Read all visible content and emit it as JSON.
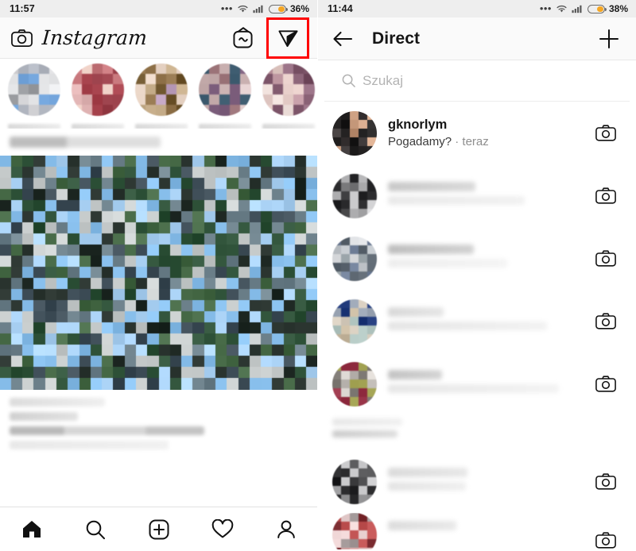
{
  "left_panel": {
    "statusbar": {
      "time": "11:57",
      "dots": "•••",
      "battery_percent": "36%",
      "battery_level": 36,
      "wifi_icon": "wifi-icon",
      "signal_icon": "signal-icon",
      "battery_icon": "battery-icon"
    },
    "header": {
      "camera_icon": "camera-icon",
      "wordmark": "Instagram",
      "igtv_icon": "igtv-icon",
      "direct_icon": "paper-plane-icon",
      "highlight_color": "#ff0000",
      "highlighted_element": "paper-plane-icon"
    },
    "stories": [
      {
        "name": "story-1",
        "blurred": true
      },
      {
        "name": "story-2",
        "blurred": true
      },
      {
        "name": "story-3",
        "blurred": true
      },
      {
        "name": "story-4",
        "blurred": true
      },
      {
        "name": "story-5",
        "blurred": true
      }
    ],
    "post": {
      "header_blurred": true,
      "photo_blurred": true,
      "caption_blurred": true
    },
    "tabbar": [
      {
        "name": "tab-home",
        "icon": "home-icon",
        "active": true
      },
      {
        "name": "tab-search",
        "icon": "search-icon",
        "active": false
      },
      {
        "name": "tab-add",
        "icon": "plus-square-icon",
        "active": false
      },
      {
        "name": "tab-activity",
        "icon": "heart-icon",
        "active": false
      },
      {
        "name": "tab-profile",
        "icon": "person-icon",
        "active": false
      }
    ]
  },
  "right_panel": {
    "statusbar": {
      "time": "11:44",
      "dots": "•••",
      "battery_percent": "38%",
      "battery_level": 38,
      "wifi_icon": "wifi-icon",
      "signal_icon": "signal-icon",
      "battery_icon": "battery-icon"
    },
    "header": {
      "back_icon": "arrow-left-icon",
      "title": "Direct",
      "new_message_icon": "plus-icon"
    },
    "search": {
      "icon": "search-icon",
      "placeholder": "Szukaj",
      "value": ""
    },
    "conversations": [
      {
        "username": "gknorlym",
        "preview": "Pogadamy?",
        "separator": "·",
        "time": "teraz",
        "blurred": false,
        "camera_icon": "camera-icon"
      },
      {
        "username": "",
        "preview": "",
        "time": "",
        "blurred": true,
        "camera_icon": "camera-icon"
      },
      {
        "username": "",
        "preview": "",
        "time": "",
        "blurred": true,
        "camera_icon": "camera-icon"
      },
      {
        "username": "",
        "preview": "",
        "time": "",
        "blurred": true,
        "camera_icon": "camera-icon"
      },
      {
        "username": "",
        "preview": "",
        "time": "",
        "blurred": true,
        "camera_icon": "camera-icon"
      },
      {
        "username": "",
        "preview": "",
        "time": "",
        "blurred": true,
        "camera_icon": "camera-icon"
      },
      {
        "username": "",
        "preview": "",
        "time": "",
        "blurred": true,
        "camera_icon": "camera-icon"
      }
    ]
  }
}
